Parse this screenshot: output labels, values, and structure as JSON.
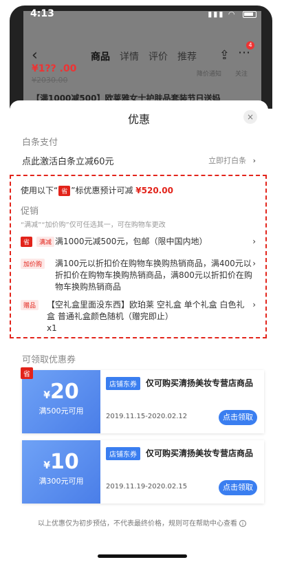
{
  "status": {
    "time": "4:13"
  },
  "nav": {
    "tabs": [
      "商品",
      "详情",
      "评价",
      "推荐"
    ],
    "active_tab": "商品",
    "badge": "4",
    "price_alert_label": "降价通知",
    "follow_label": "关注"
  },
  "product": {
    "price": "¥1?? .00",
    "old_price": "¥2030.00",
    "title": "【满1000减500】欧莱雅女士护肤品套装节日送妈"
  },
  "sheet": {
    "title": "优惠",
    "close": "×"
  },
  "baitiao": {
    "section": "白条支付",
    "text": "点此激活白条立减60元",
    "action": "立即打白条",
    "arrow": "›"
  },
  "promo": {
    "headline_prefix": "使用以下“",
    "headline_tag": "省",
    "headline_suffix": "”标优惠预计可减",
    "headline_amount": "¥520.00",
    "section": "促销",
    "note": "“满减”“加价购”仅可任选其一，可在购物车更改",
    "items": [
      {
        "tag1": "省",
        "tag2": "满减",
        "text": "满1000元减500元，包邮（限中国内地）"
      },
      {
        "tag1": "加价购",
        "text": "满100元以折扣价在购物车换购热销商品，满400元以折扣价在购物车换购热销商品，满800元以折扣价在购物车换购热销商品"
      },
      {
        "tag1": "赠品",
        "text": "【空礼盒里面没东西】欧珀莱 空礼盒 单个礼盒 白色礼盒 普通礼盒颜色随机（赠完即止）",
        "qty": "x1"
      }
    ]
  },
  "coupons": {
    "section": "可领取优惠券",
    "items": [
      {
        "sheng": "省",
        "currency": "¥",
        "amount": "20",
        "condition": "满500元可用",
        "tag": "店铺东券",
        "desc": "仅可购买清扬美妆专营店商品",
        "date": "2019.11.15-2020.02.12",
        "button": "点击领取"
      },
      {
        "currency": "¥",
        "amount": "10",
        "condition": "满300元可用",
        "tag": "店铺东券",
        "desc": "仅可购买清扬美妆专营店商品",
        "date": "2019.11.19-2020.02.15",
        "button": "点击领取"
      }
    ]
  },
  "disclaimer": "以上优惠仅为初步预估，不代表最终价格，规则可在帮助中心查看",
  "colors": {
    "accent_red": "#e2231a",
    "coupon_blue": "#4a7ee8"
  }
}
